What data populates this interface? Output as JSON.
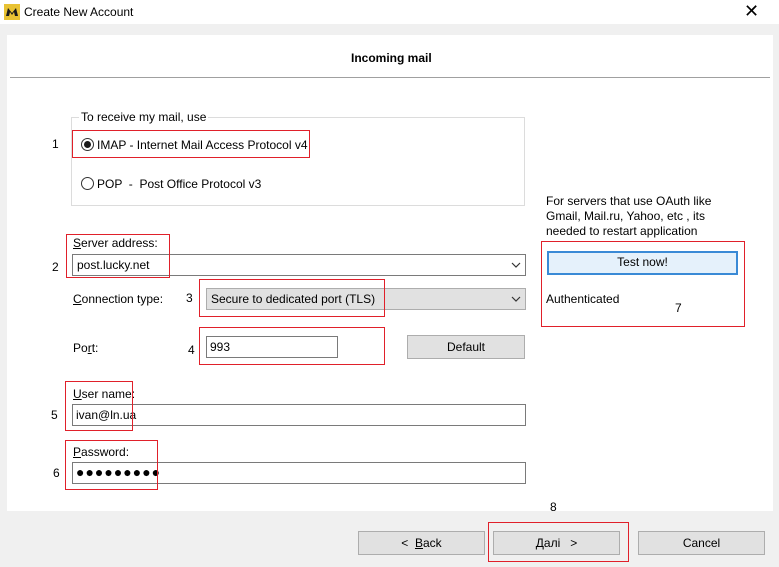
{
  "window": {
    "title": "Create New Account",
    "close_glyph": "✕"
  },
  "header": {
    "title": "Incoming mail"
  },
  "group": {
    "legend": "To receive my mail, use",
    "options": [
      {
        "label": "IMAP - Internet Mail Access Protocol v4",
        "checked": true
      },
      {
        "label": "POP  -  Post Office Protocol v3",
        "checked": false
      }
    ]
  },
  "server": {
    "label_underlined": "S",
    "label_rest": "erver address:",
    "value": "post.lucky.net"
  },
  "connection": {
    "label_pre": "C",
    "label_rest": "onnection type:",
    "value": "Secure to dedicated port (TLS)"
  },
  "port": {
    "label_pre": "Po",
    "label_ul": "r",
    "label_rest": "t:",
    "value": "993",
    "default_button": "Default"
  },
  "username": {
    "label_ul": "U",
    "label_rest": "ser name:",
    "value": "ivan@ln.ua"
  },
  "password": {
    "label_ul": "P",
    "label_rest": "assword:",
    "value": "●●●●●●●●●"
  },
  "oauth": {
    "note": "For servers that use OAuth like Gmail, Mail.ru, Yahoo, etc , its needed to restart application",
    "test_button": "Test now!",
    "status": "Authenticated"
  },
  "annotations": [
    "1",
    "2",
    "3",
    "4",
    "5",
    "6",
    "7",
    "8"
  ],
  "footer": {
    "back_pre": "<  ",
    "back_ul": "B",
    "back_rest": "ack",
    "next_ul": "Д",
    "next_rest": "алі   >",
    "cancel": "Cancel"
  },
  "colors": {
    "annotation_red": "#e0202a",
    "focus_blue": "#3a8ad6",
    "button_gray": "#e1e1e1"
  }
}
